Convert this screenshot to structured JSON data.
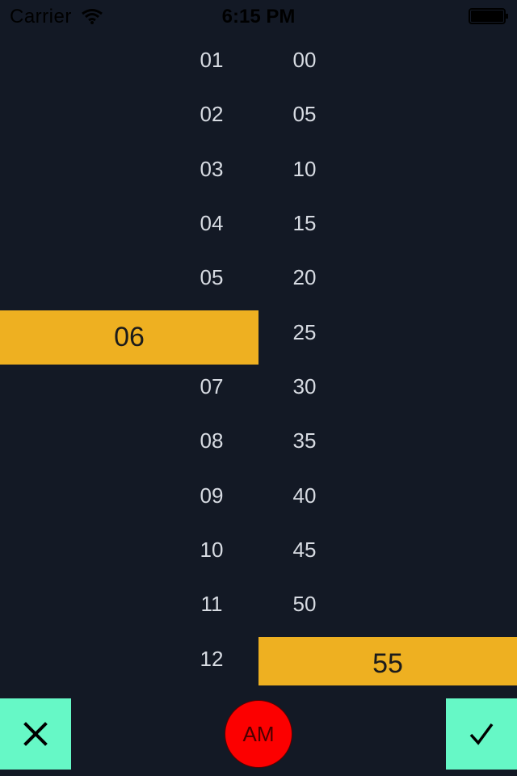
{
  "status_bar": {
    "carrier": "Carrier",
    "time": "6:15 PM"
  },
  "hours": {
    "items": [
      "01",
      "02",
      "03",
      "04",
      "05",
      "07",
      "08",
      "09",
      "10",
      "11",
      "12"
    ],
    "selected": "06"
  },
  "minutes": {
    "items": [
      "00",
      "05",
      "10",
      "15",
      "20",
      "25",
      "30",
      "35",
      "40",
      "45",
      "50"
    ],
    "selected": "55"
  },
  "controls": {
    "ampm_label": "AM",
    "cancel_icon": "close-icon",
    "confirm_icon": "checkmark-icon"
  },
  "colors": {
    "background": "#131925",
    "highlight": "#eeb021",
    "action_button": "#66f8c6",
    "ampm_button": "#fc0000"
  }
}
